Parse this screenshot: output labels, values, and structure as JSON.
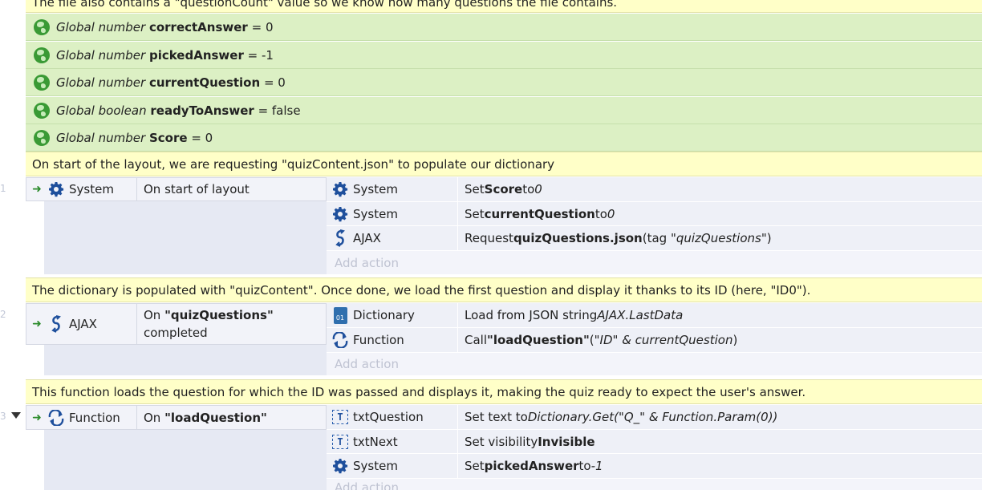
{
  "top_comment": "The file also contains a \"questionCount\" value so we know how many questions the file contains.",
  "globals": [
    {
      "type": "Global number",
      "name": "correctAnswer",
      "value": "= 0"
    },
    {
      "type": "Global number",
      "name": "pickedAnswer",
      "value": "= -1"
    },
    {
      "type": "Global number",
      "name": "currentQuestion",
      "value": "= 0"
    },
    {
      "type": "Global boolean",
      "name": "readyToAnswer",
      "value": "= false"
    },
    {
      "type": "Global number",
      "name": "Score",
      "value": "= 0"
    }
  ],
  "events": [
    {
      "comment": "On start of the layout, we are requesting \"quizContent.json\" to populate our dictionary",
      "condition": {
        "object": "System",
        "pre": "On start of layout",
        "bold": "",
        "post": ""
      },
      "actions": [
        {
          "object": "System",
          "pre": "Set ",
          "bold": "Score",
          "mid": " to ",
          "italic": "0",
          "post": ""
        },
        {
          "object": "System",
          "pre": "Set ",
          "bold": "currentQuestion",
          "mid": " to ",
          "italic": "0",
          "post": ""
        },
        {
          "object": "AJAX",
          "pre": "Request ",
          "bold": "quizQuestions.json",
          "mid": " (tag \"",
          "italic": "quizQuestions",
          "post": "\")"
        }
      ],
      "add_action": "Add action"
    },
    {
      "comment": "The dictionary is populated with \"quizContent\". Once done, we load the first question and display it thanks to its ID (here, \"ID0\").",
      "condition": {
        "object": "AJAX",
        "pre": "On ",
        "bold": "\"quizQuestions\"",
        "post": "completed"
      },
      "actions": [
        {
          "object": "Dictionary",
          "pre": "Load from JSON string ",
          "bold": "",
          "mid": "",
          "italic": "AJAX.LastData",
          "post": ""
        },
        {
          "object": "Function",
          "pre": "Call ",
          "bold": "\"loadQuestion\"",
          "mid": " (\"",
          "italic": "ID\" & currentQuestion",
          "post": ")"
        }
      ],
      "add_action": "Add action"
    },
    {
      "comment": "This function loads the question for which the ID was passed and displays it, making the quiz ready to expect the user's answer.",
      "condition": {
        "object": "Function",
        "pre": "On ",
        "bold": "\"loadQuestion\"",
        "post": ""
      },
      "actions": [
        {
          "object": "txtQuestion",
          "pre": "Set text to ",
          "bold": "",
          "mid": "",
          "italic": "Dictionary.Get(\"Q_\" & Function.Param(0))",
          "post": ""
        },
        {
          "object": "txtNext",
          "pre": "Set visibility ",
          "bold": "Invisible",
          "mid": "",
          "italic": "",
          "post": ""
        },
        {
          "object": "System",
          "pre": "Set ",
          "bold": "pickedAnswer",
          "mid": " to ",
          "italic": "-1",
          "post": ""
        }
      ],
      "add_action": "Add action"
    }
  ],
  "side_numbers": [
    "1",
    "2",
    "3"
  ],
  "colors": {
    "comment_bg": "#ffffc8",
    "global_bg": "#dcf0c4",
    "event_bg": "#e6e9f3",
    "accent_blue": "#2b5fae"
  }
}
